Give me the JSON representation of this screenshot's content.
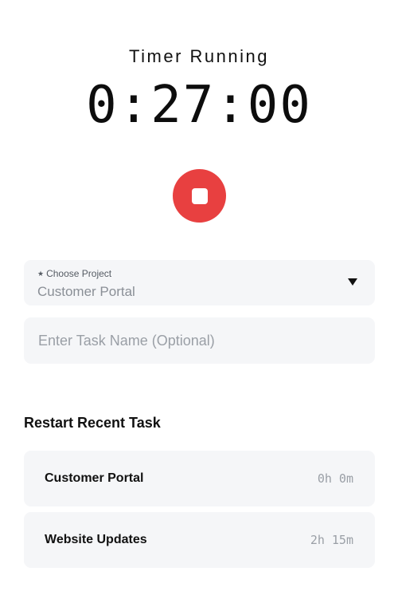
{
  "timer": {
    "title": "Timer Running",
    "elapsed": "0:27:00"
  },
  "controls": {
    "stop_button_color": "#e84040"
  },
  "project_select": {
    "required_marker": "★",
    "label": "Choose Project",
    "value": "Customer Portal"
  },
  "task_input": {
    "placeholder": "Enter Task Name (Optional)",
    "value": ""
  },
  "recent": {
    "heading": "Restart Recent Task",
    "items": [
      {
        "name": "Customer Portal",
        "time": "0h 0m"
      },
      {
        "name": "Website Updates",
        "time": "2h 15m"
      }
    ]
  }
}
